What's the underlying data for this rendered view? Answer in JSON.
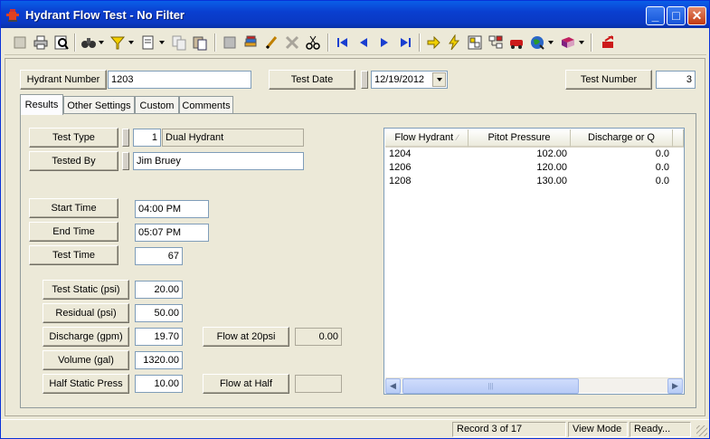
{
  "window": {
    "title": "Hydrant Flow Test - No Filter",
    "minimize_glyph": "_",
    "maximize_glyph": "□",
    "close_glyph": "✕"
  },
  "header": {
    "hydrant_number_label": "Hydrant Number",
    "hydrant_number_value": "1203",
    "test_date_label": "Test Date",
    "test_date_value": "12/19/2012",
    "test_number_label": "Test Number",
    "test_number_value": "3"
  },
  "tabs": [
    {
      "label": "Results"
    },
    {
      "label": "Other Settings"
    },
    {
      "label": "Custom"
    },
    {
      "label": "Comments"
    }
  ],
  "results": {
    "test_type_label": "Test Type",
    "test_type_code": "1",
    "test_type_desc": "Dual Hydrant",
    "tested_by_label": "Tested By",
    "tested_by_value": "Jim Bruey",
    "start_time_label": "Start Time",
    "start_time_value": "04:00 PM",
    "end_time_label": "End Time",
    "end_time_value": "05:07 PM",
    "test_time_label": "Test Time",
    "test_time_value": "67",
    "test_static_label": "Test Static (psi)",
    "test_static_value": "20.00",
    "residual_label": "Residual (psi)",
    "residual_value": "50.00",
    "discharge_label": "Discharge (gpm)",
    "discharge_value": "19.70",
    "volume_label": "Volume  (gal)",
    "volume_value": "1320.00",
    "half_static_label": "Half Static Press",
    "half_static_value": "10.00",
    "flow20_label": "Flow at 20psi",
    "flow20_value": "0.00",
    "flowhalf_label": "Flow at Half",
    "flowhalf_value": ""
  },
  "grid": {
    "columns": [
      "Flow Hydrant",
      "Pitot Pressure",
      "Discharge or Q"
    ],
    "rows": [
      [
        "1204",
        "102.00",
        "0.0"
      ],
      [
        "1206",
        "120.00",
        "0.0"
      ],
      [
        "1208",
        "130.00",
        "0.0"
      ]
    ]
  },
  "status": {
    "record": "Record 3 of 17",
    "mode": "View Mode",
    "state": "Ready..."
  },
  "colors": {
    "titlebar": "#0a3fd0",
    "accent_blue": "#1a3fd0",
    "toolbar_red": "#cc1a1a"
  },
  "icons": [
    "app-hydrant-icon",
    "blank-page-icon",
    "print-icon",
    "print-preview-icon",
    "binoculars-icon",
    "filter-icon",
    "report-icon",
    "copy-icon",
    "paste-icon",
    "table-icon",
    "stack-icon",
    "pencil-icon",
    "delete-icon",
    "cut-icon",
    "first-record-icon",
    "previous-record-icon",
    "next-record-icon",
    "last-record-icon",
    "jump-arrow-icon",
    "lightning-icon",
    "grid-config-icon",
    "hierarchy-icon",
    "red-truck-icon",
    "globe-icon",
    "book-icon",
    "exit-icon"
  ]
}
